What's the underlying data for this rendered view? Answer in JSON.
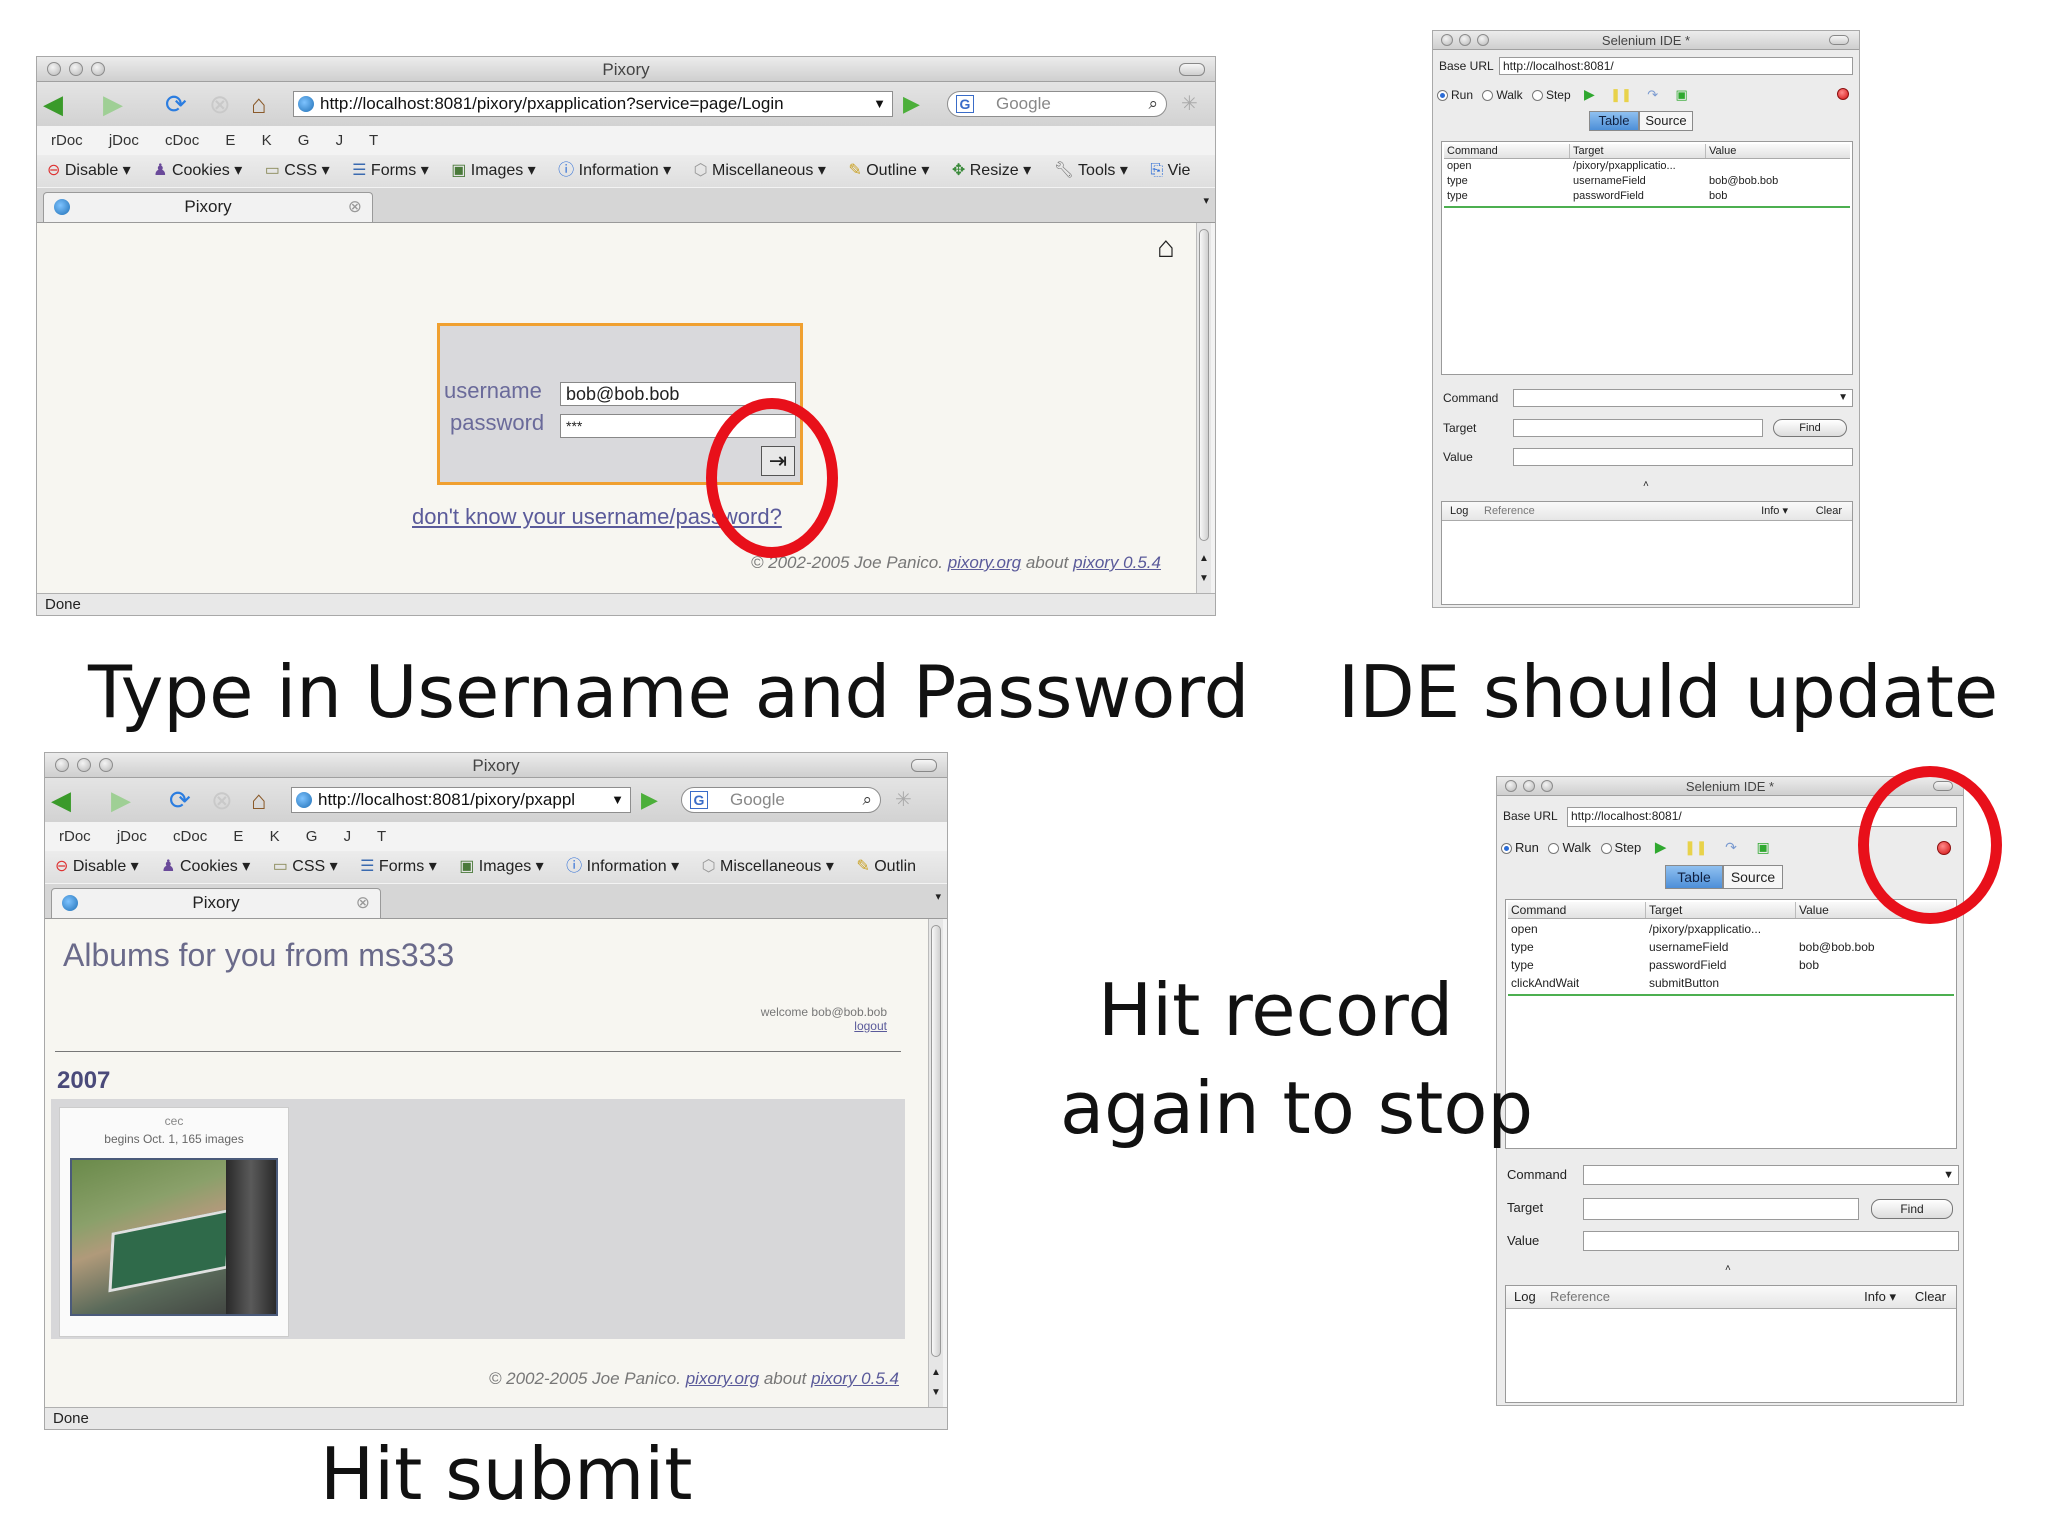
{
  "browser1": {
    "title": "Pixory",
    "url": "http://localhost:8081/pixory/pxapplication?service=page/Login",
    "search_placeholder": "Google",
    "devbar": [
      "rDoc",
      "jDoc",
      "cDoc",
      "E",
      "K",
      "G",
      "J",
      "T"
    ],
    "webdev": [
      "Disable",
      "Cookies",
      "CSS",
      "Forms",
      "Images",
      "Information",
      "Miscellaneous",
      "Outline",
      "Resize",
      "Tools",
      "Vie"
    ],
    "tab": "Pixory",
    "username_label": "username",
    "username_value": "bob@bob.bob",
    "password_label": "password",
    "password_value": "***",
    "forgot_link": "don't know your username/password?",
    "footer_copy": "© 2002-2005 Joe Panico.",
    "footer_link1": "pixory.org",
    "footer_about": "about",
    "footer_link2": "pixory 0.5.4",
    "status": "Done"
  },
  "browser2": {
    "title": "Pixory",
    "url": "http://localhost:8081/pixory/pxappl",
    "search_placeholder": "Google",
    "devbar": [
      "rDoc",
      "jDoc",
      "cDoc",
      "E",
      "K",
      "G",
      "J",
      "T"
    ],
    "webdev": [
      "Disable",
      "Cookies",
      "CSS",
      "Forms",
      "Images",
      "Information",
      "Miscellaneous",
      "Outlin"
    ],
    "tab": "Pixory",
    "heading": "Albums for you from ms333",
    "welcome": "welcome bob@bob.bob",
    "logout": "logout",
    "year": "2007",
    "album_name": "cec",
    "album_info": "begins Oct. 1, 165 images",
    "footer_copy": "© 2002-2005 Joe Panico.",
    "footer_link1": "pixory.org",
    "footer_about": "about",
    "footer_link2": "pixory 0.5.4",
    "status": "Done"
  },
  "ide1": {
    "title": "Selenium IDE *",
    "base_url_label": "Base URL",
    "base_url": "http://localhost:8081/",
    "run": "Run",
    "walk": "Walk",
    "step": "Step",
    "tab_table": "Table",
    "tab_source": "Source",
    "col_command": "Command",
    "col_target": "Target",
    "col_value": "Value",
    "rows": [
      {
        "command": "open",
        "target": "/pixory/pxapplicatio...",
        "value": ""
      },
      {
        "command": "type",
        "target": "usernameField",
        "value": "bob@bob.bob"
      },
      {
        "command": "type",
        "target": "passwordField",
        "value": "bob"
      }
    ],
    "command_label": "Command",
    "target_label": "Target",
    "value_label": "Value",
    "find": "Find",
    "log": "Log",
    "reference": "Reference",
    "info": "Info",
    "clear": "Clear"
  },
  "ide2": {
    "title": "Selenium IDE *",
    "base_url_label": "Base URL",
    "base_url": "http://localhost:8081/",
    "run": "Run",
    "walk": "Walk",
    "step": "Step",
    "tab_table": "Table",
    "tab_source": "Source",
    "col_command": "Command",
    "col_target": "Target",
    "col_value": "Value",
    "rows": [
      {
        "command": "open",
        "target": "/pixory/pxapplicatio...",
        "value": ""
      },
      {
        "command": "type",
        "target": "usernameField",
        "value": "bob@bob.bob"
      },
      {
        "command": "type",
        "target": "passwordField",
        "value": "bob"
      },
      {
        "command": "clickAndWait",
        "target": "submitButton",
        "value": ""
      }
    ],
    "command_label": "Command",
    "target_label": "Target",
    "value_label": "Value",
    "find": "Find",
    "log": "Log",
    "reference": "Reference",
    "info": "Info",
    "clear": "Clear"
  },
  "captions": {
    "top_left": "Type in Username and Password",
    "top_right": "IDE should update",
    "middle_line1": "Hit record",
    "middle_line2": "again to stop",
    "bottom": "Hit submit"
  },
  "colors": {
    "highlight_circle": "#e8101a",
    "login_border": "#f0a030",
    "link": "#5a5a9a"
  }
}
